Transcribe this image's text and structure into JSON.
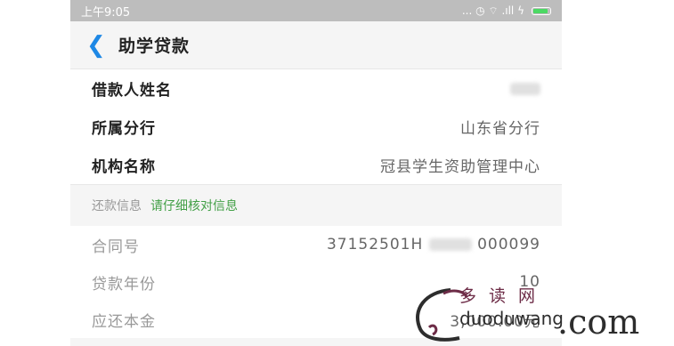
{
  "status": {
    "time": "上午9:05",
    "icons": "... ◷ ⌔ .ıll ϟ"
  },
  "header": {
    "title": "助学贷款"
  },
  "info": [
    {
      "label": "借款人姓名",
      "value": ""
    },
    {
      "label": "所属分行",
      "value": "山东省分行"
    },
    {
      "label": "机构名称",
      "value": "冠县学生资助管理中心"
    }
  ],
  "repay": {
    "section_title": "还款信息",
    "hint": "请仔细核对信息",
    "contract": {
      "label": "合同号",
      "value_start": "37152501H",
      "value_end": "000099"
    },
    "year": {
      "label": "贷款年份",
      "value": "10"
    },
    "principal": {
      "label": "应还本金",
      "value": "3,000.00元"
    }
  },
  "watermark": {
    "cn": "多读网",
    "site": "duoduwang",
    "tld": ".com"
  }
}
